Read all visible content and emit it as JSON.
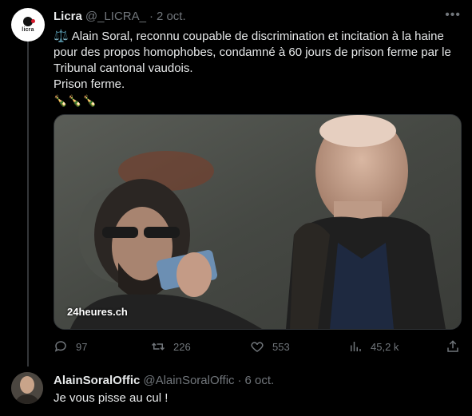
{
  "tweet": {
    "author_name": "Licra",
    "handle": "@_LICRA_",
    "separator": "·",
    "date": "2 oct.",
    "avatar_text": "licra",
    "emoji": "⚖️",
    "text_line1": "Alain Soral, reconnu coupable de discrimination et incitation à la haine pour des propos homophobes, condamné à 60 jours de prison ferme par le Tribunal cantonal vaudois.",
    "text_line2": "Prison ferme.",
    "emoji_line": "🍾🍾🍾",
    "media_credit": "24heures.ch",
    "more_icon": "more-horizontal-icon",
    "actions": {
      "replies": "97",
      "retweets": "226",
      "likes": "553",
      "views": "45,2 k"
    }
  },
  "reply": {
    "author_name": "AlainSoralOffic",
    "handle": "@AlainSoralOffic",
    "separator": "·",
    "date": "6 oct.",
    "text": "Je vous pisse au cul !"
  },
  "colors": {
    "background": "#000000",
    "text": "#e7e9ea",
    "muted": "#71767b",
    "thread_line": "#333639"
  }
}
